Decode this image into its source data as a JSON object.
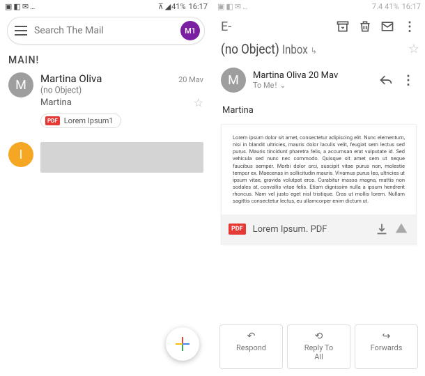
{
  "left": {
    "status": {
      "battery": "41%",
      "time": "16:17",
      "signal_icon": "signal-icon"
    },
    "search_placeholder": "Search The Mail",
    "profile_initials": "M1",
    "section_label": "MAIN!",
    "mail1": {
      "avatar_letter": "M",
      "sender": "Martina Oliva",
      "date": "20 Mav",
      "subject": "(no Object)",
      "snippet": "Martina",
      "attachment_badge": "PDF",
      "attachment_name": "Lorem Ipsum1"
    },
    "mail2": {
      "avatar_letter": "I"
    }
  },
  "right": {
    "status": {
      "prefix": "7.4",
      "battery": "41%",
      "time": "16:17"
    },
    "brand": "E-",
    "subject": "(no Object)",
    "subject_label": "Inbox",
    "from": "Martina Oliva 20 Mav",
    "to": "To Me",
    "body_line": "Martina",
    "lorem": "Lorem ipsum dolor sit amet, consectetur adipiscing elit. Nunc elementum, nisi in blandit ultricies, mauris dolor laculis velit, feugiat sem lectus sed purus. Mauris tincidunt pharetra felis, a accumsan erat vulputate id. Sed vehicula sed nunc nec commodo. Quisque sit amet sem ut neque faucibus semper. Morbi dolor orci, suscipit vitae purus non, molestie tempor ex. Maecenas in sollicitudin mauris. Vivamus purus leo, ultricies ut ipsum vitae, gravida volutpat eros. Curabitur massa magna, mattis non sodales at, convallis vitae felis. Etiam dignissim nulla a ipsum hendrerit rhoncus. Nam vel justo eget nisl tristique. Cras ut mollis lorem. Nullam sagittis consectetur lectus, eu ullamcorper enim dictum ut.",
    "attachment": {
      "badge": "PDF",
      "filename": "Lorem Ipsum. PDF"
    },
    "actions": {
      "reply": "Respond",
      "reply_all_l1": "Reply To",
      "reply_all_l2": "All",
      "forward": "Forwards"
    }
  }
}
